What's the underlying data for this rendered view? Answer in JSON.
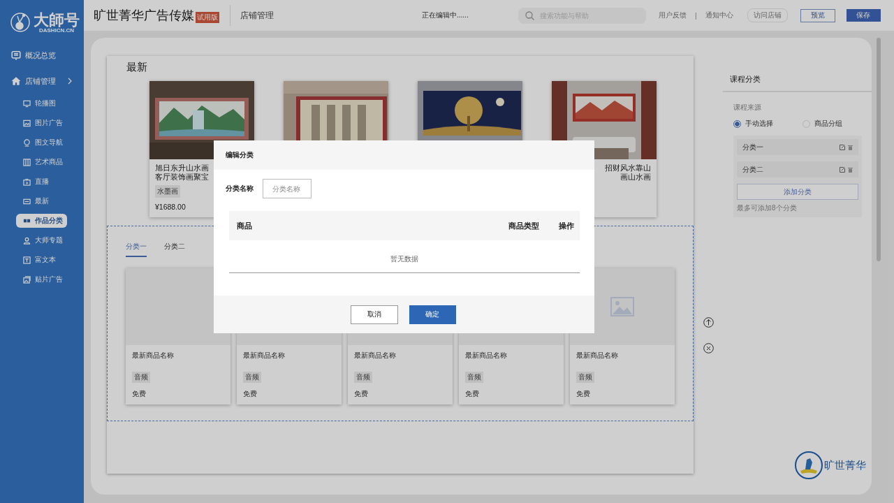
{
  "brand": {
    "name": "大師号",
    "domain": "DASHICN.CN"
  },
  "sidebar": {
    "items": [
      {
        "label": "概况总览"
      },
      {
        "label": "店铺管理",
        "expanded": true,
        "children": [
          {
            "label": "轮播图",
            "selected": false
          },
          {
            "label": "图片广告",
            "selected": false
          },
          {
            "label": "图文导航",
            "selected": false
          },
          {
            "label": "艺术商品",
            "selected": false
          },
          {
            "label": "直播",
            "selected": false
          },
          {
            "label": "最新",
            "selected": false
          },
          {
            "label": "作品分类",
            "selected": true
          },
          {
            "label": "大师专题",
            "selected": false
          },
          {
            "label": "富文本",
            "selected": false
          },
          {
            "label": "贴片广告",
            "selected": false
          }
        ]
      }
    ]
  },
  "header": {
    "title": "旷世菁华广告传媒",
    "badge": "试用版",
    "section": "店铺管理",
    "status": "正在编辑中......",
    "search": {
      "placeholder": "搜索功能与帮助"
    },
    "links": [
      "用户反馈",
      "通知中心"
    ],
    "separator": "|",
    "visit": "访问店铺",
    "preview": "预览",
    "save": "保存"
  },
  "canvas": {
    "title": "最新",
    "products": [
      {
        "kind": "full",
        "title_lines": [
          "旭日东升山水画",
          "客厅装饰画聚宝"
        ],
        "tag": "水墨画",
        "price": "¥1688.00"
      },
      {
        "kind": "covered"
      },
      {
        "kind": "covered"
      },
      {
        "kind": "covered",
        "title_lines": [
          "招财风水靠山",
          "画山水画"
        ]
      }
    ],
    "tabs": [
      {
        "label": "分类一",
        "selected": true
      },
      {
        "label": "分类二",
        "selected": false
      }
    ],
    "items": [
      {
        "kind": "covered",
        "name": "最新商品名称",
        "tag": "音频",
        "price": "免费"
      },
      {
        "kind": "covered",
        "name": "最新商品名称",
        "tag": "音频",
        "price": "免费"
      },
      {
        "kind": "covered",
        "name": "最新商品名称",
        "tag": "音频",
        "price": "免费"
      },
      {
        "kind": "full",
        "name": "最新商品名称",
        "tag": "音频",
        "price": "免费"
      },
      {
        "kind": "full",
        "name": "最新商品名称",
        "tag": "音频",
        "price": "免费"
      }
    ]
  },
  "settings": {
    "title": "课程分类",
    "source_label": "课程来源",
    "sources": [
      {
        "label": "手动选择",
        "selected": true
      },
      {
        "label": "商品分组",
        "selected": false
      }
    ],
    "categories": [
      "分类一",
      "分类二"
    ],
    "add": "添加分类",
    "hint": "最多可添加8个分类"
  },
  "footer_logo": {
    "text": "旷世菁华"
  },
  "dialog": {
    "title": "编辑分类",
    "field_label": "分类名称",
    "field": {
      "placeholder": "分类名称"
    },
    "columns": [
      "商品",
      "商品类型",
      "操作"
    ],
    "empty": "暂无数据",
    "cancel": "取消",
    "confirm": "确定"
  }
}
